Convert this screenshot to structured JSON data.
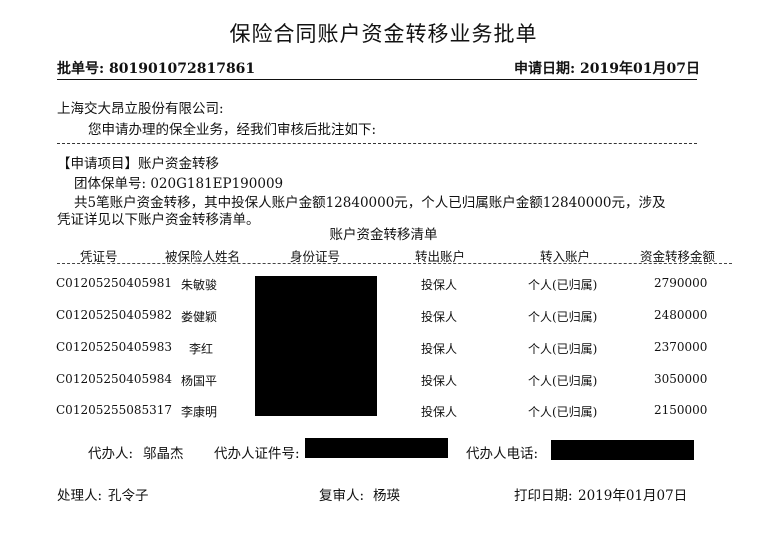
{
  "title": "保险合同账户资金转移业务批单",
  "header": {
    "batch_label": "批单号:",
    "batch_no": "801901072817861",
    "date_label": "申请日期:",
    "date": "2019年01月07日"
  },
  "intro": {
    "company": "上海交大昂立股份有限公司:",
    "line": "您申请办理的保全业务，经我们审核后批注如下:"
  },
  "application": {
    "item": "【申请项目】账户资金转移",
    "policy": "团体保单号: 020G181EP190009",
    "desc1": "共5笔账户资金转移，其中投保人账户金额12840000元，个人已归属账户金额12840000元，涉及",
    "desc2": "凭证详见以下账户资金转移清单。"
  },
  "table": {
    "title": "账户资金转移清单",
    "headers": [
      "凭证号",
      "被保险人姓名",
      "身份证号",
      "转出账户",
      "转入账户",
      "资金转移金额"
    ],
    "rows": [
      {
        "voucher": "C01205250405981",
        "name": "朱敏骏",
        "from": "投保人",
        "to": "个人(已归属)",
        "amount": "2790000"
      },
      {
        "voucher": "C01205250405982",
        "name": "娄健颖",
        "from": "投保人",
        "to": "个人(已归属)",
        "amount": "2480000"
      },
      {
        "voucher": "C01205250405983",
        "name": "李红",
        "from": "投保人",
        "to": "个人(已归属)",
        "amount": "2370000"
      },
      {
        "voucher": "C01205250405984",
        "name": "杨国平",
        "from": "投保人",
        "to": "个人(已归属)",
        "amount": "3050000"
      },
      {
        "voucher": "C01205255085317",
        "name": "李康明",
        "from": "投保人",
        "to": "个人(已归属)",
        "amount": "2150000"
      }
    ]
  },
  "agent": {
    "name_label": "代办人:",
    "name": "邬晶杰",
    "id_label": "代办人证件号:",
    "phone_label": "代办人电话:"
  },
  "footer": {
    "handler_label": "处理人:",
    "handler": "孔令子",
    "reviewer_label": "复审人:",
    "reviewer": "杨瑛",
    "print_label": "打印日期:",
    "print_date": "2019年01月07日"
  }
}
